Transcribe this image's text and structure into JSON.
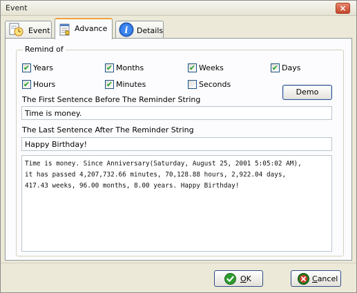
{
  "window": {
    "title": "Event",
    "close_glyph": "×"
  },
  "tabs": [
    {
      "label": "Event",
      "icon": "clock-document-icon"
    },
    {
      "label": "Advance",
      "icon": "notepad-icon"
    },
    {
      "label": "Details",
      "icon": "info-icon"
    }
  ],
  "active_tab": "Advance",
  "remind_of": {
    "title": "Remind of",
    "options": [
      {
        "label": "Years",
        "checked": true
      },
      {
        "label": "Months",
        "checked": true
      },
      {
        "label": "Weeks",
        "checked": true
      },
      {
        "label": "Days",
        "checked": true
      },
      {
        "label": "Hours",
        "checked": true
      },
      {
        "label": "Minutes",
        "checked": true
      },
      {
        "label": "Seconds",
        "checked": false
      }
    ]
  },
  "demo_button": "Demo",
  "first_sentence": {
    "label": "The First Sentence Before The Reminder String",
    "value": "Time is money."
  },
  "last_sentence": {
    "label": "The Last Sentence After The Reminder String",
    "value": "Happy Birthday!"
  },
  "preview_text": "Time is money. Since Anniversary(Saturday, August 25, 2001 5:05:02 AM),\nit has passed 4,207,732.66 minutes, 70,128.88 hours, 2,922.04 days,\n417.43 weeks, 96.00 months, 8.00 years. Happy Birthday!",
  "ok_button": {
    "mnemonic": "O",
    "rest": "K"
  },
  "cancel_button": {
    "mnemonic": "C",
    "rest": "ancel"
  },
  "colors": {
    "accent_tab": "#f0a339",
    "check": "#21a121",
    "ok_icon": "#2e9b2e",
    "cancel_icon": "#1f7a1f"
  }
}
